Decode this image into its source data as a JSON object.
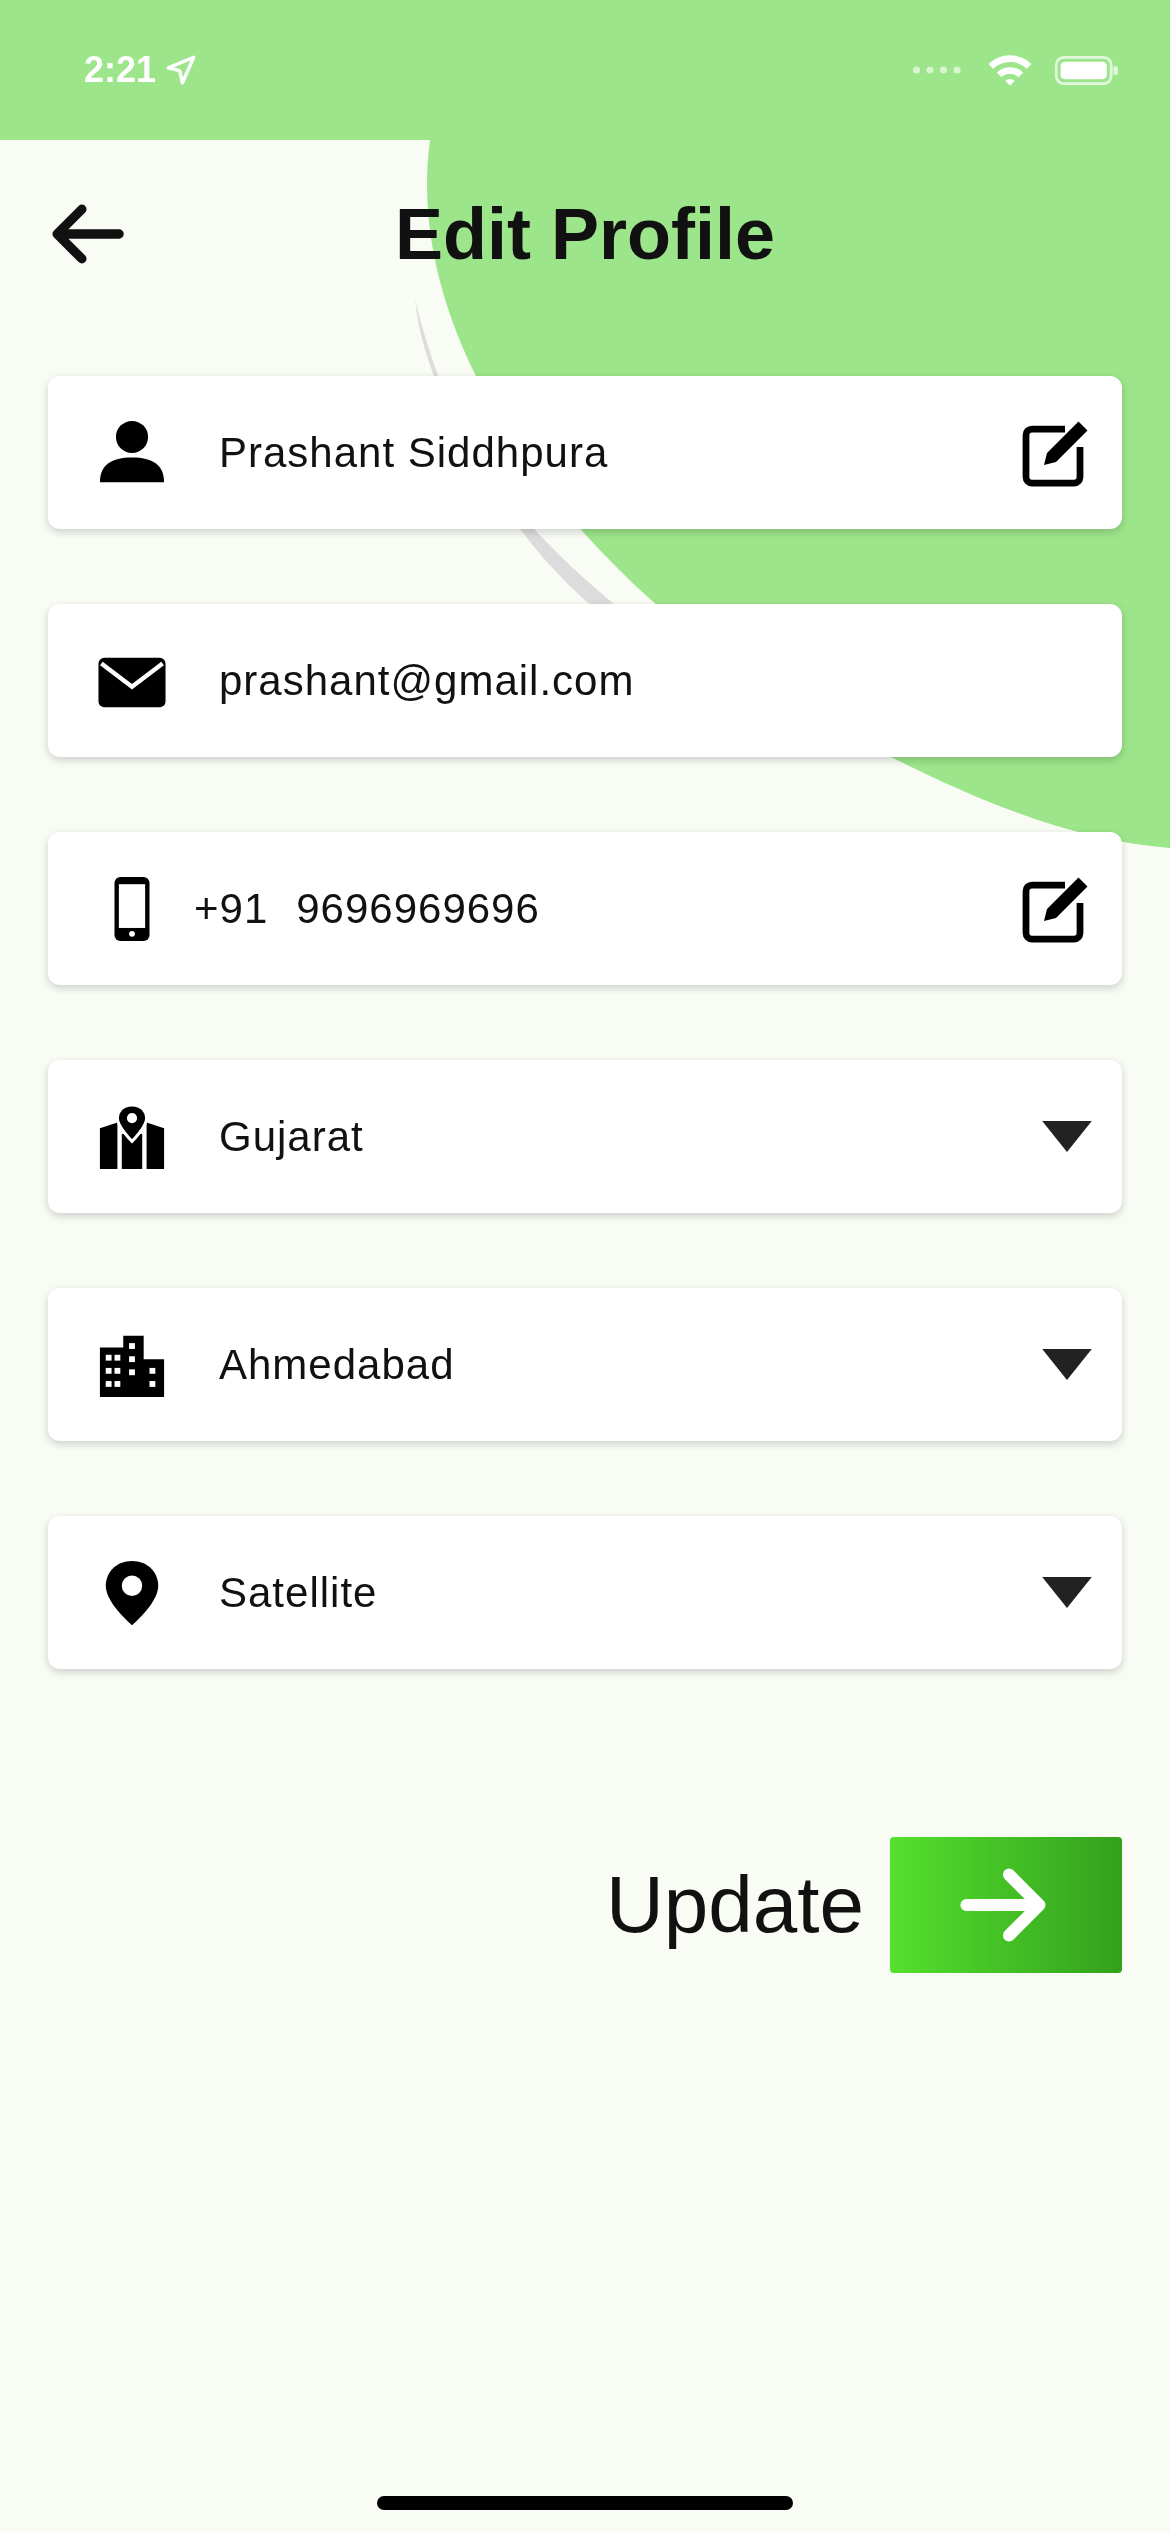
{
  "status_bar": {
    "time": "2:21"
  },
  "header": {
    "title": "Edit Profile"
  },
  "fields": [
    {
      "kind": "text",
      "value": "Prashant Siddhpura",
      "editable": true
    },
    {
      "kind": "text",
      "value": "prashant@gmail.com",
      "editable": false
    },
    {
      "kind": "phone",
      "prefix": "+91",
      "value": "9696969696",
      "editable": true
    },
    {
      "kind": "dropdown",
      "value": "Gujarat"
    },
    {
      "kind": "dropdown",
      "value": "Ahmedabad"
    },
    {
      "kind": "dropdown",
      "value": "Satellite"
    }
  ],
  "submit": {
    "label": "Update"
  }
}
